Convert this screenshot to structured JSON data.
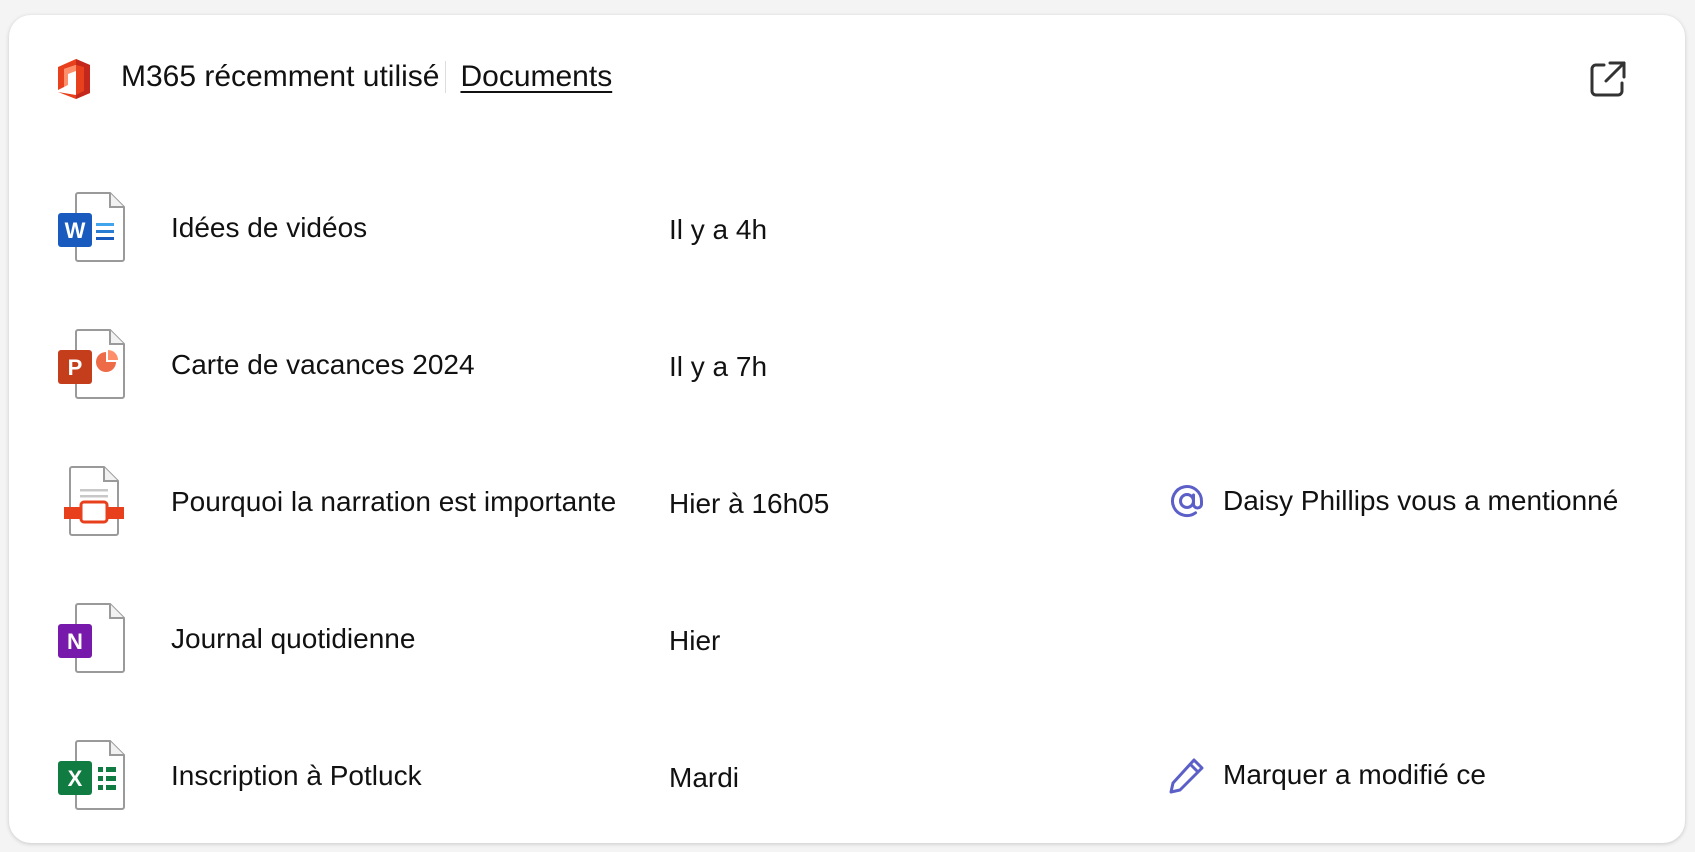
{
  "header": {
    "app_name": "M365 récemment utilisé",
    "tab_label": "Documents"
  },
  "colors": {
    "word": "#185abd",
    "powerpoint": "#c43e1c",
    "onenote": "#7719aa",
    "excel": "#107c41",
    "accent": "#5b5fc7"
  },
  "files": [
    {
      "icon": "word-file-icon",
      "name": "Idées de vidéos",
      "time": "Il y a 4h",
      "activity": ""
    },
    {
      "icon": "powerpoint-file-icon",
      "name": "Carte de vacances 2024",
      "time": "Il y a 7h",
      "activity": ""
    },
    {
      "icon": "presentation-doc-icon",
      "name": "Pourquoi la narration est importante",
      "time": "Hier à 16h05",
      "activity_icon": "at-mention-icon",
      "activity": "Daisy Phillips vous a mentionné"
    },
    {
      "icon": "onenote-file-icon",
      "name": "Journal quotidienne",
      "time": "Hier",
      "activity": ""
    },
    {
      "icon": "excel-file-icon",
      "name": "Inscription à Potluck",
      "time": "Mardi",
      "activity_icon": "pencil-edit-icon",
      "activity": "Marquer a modifié ce"
    }
  ]
}
